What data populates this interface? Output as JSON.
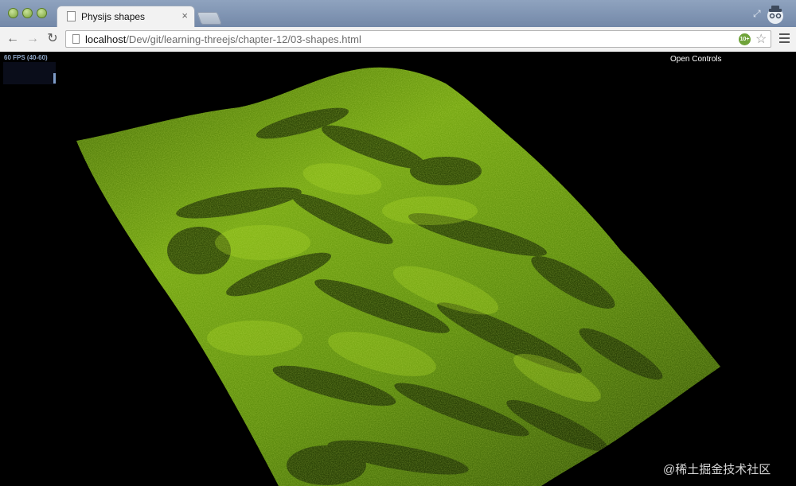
{
  "window": {
    "tab_title": "Physijs shapes",
    "tab_close_glyph": "×",
    "icons": [
      "close-window-icon",
      "minimize-window-icon",
      "zoom-window-icon",
      "page-icon",
      "new-tab-icon",
      "incognito-icon",
      "fullscreen-icon"
    ]
  },
  "toolbar": {
    "back_glyph": "←",
    "forward_glyph": "→",
    "reload_glyph": "↻",
    "url_host": "localhost",
    "url_path": "/Dev/git/learning-threejs/chapter-12/03-shapes.html",
    "extension_badge": "10+",
    "star_glyph": "☆"
  },
  "page": {
    "fps_label": "60 FPS (40-60)",
    "controls_label": "Open Controls",
    "watermark": "@稀土掘金技术社区",
    "colors": {
      "terrain_light": "#8cc018",
      "terrain_mid": "#5a8a10",
      "terrain_dark": "#1f3306",
      "background": "#000000"
    }
  }
}
